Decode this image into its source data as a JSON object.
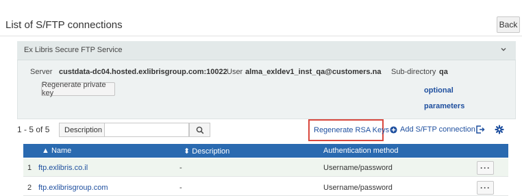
{
  "page": {
    "title": "List of S/FTP connections",
    "back_label": "Back"
  },
  "panel": {
    "title": "Ex Libris Secure FTP Service",
    "server_label": "Server",
    "server_value": "custdata-dc04.hosted.exlibrisgroup.com:10022",
    "user_label": "User",
    "user_value": "alma_exldev1_inst_qa@customers.na",
    "subdir_label": "Sub-directory",
    "subdir_value": "qa",
    "regen_key_label": "Regenerate private key",
    "optional_line1": "optional",
    "optional_line2": "parameters"
  },
  "toolbar": {
    "count": "1 - 5 of 5",
    "field_label": "Description",
    "search_value": "",
    "regen_rsa_label": "Regenerate RSA Keys",
    "add_label": "Add S/FTP connection"
  },
  "table": {
    "headers": {
      "name": "▲ Name",
      "description": "⬍ Description",
      "auth": "Authentication method"
    },
    "rows": [
      {
        "num": "1",
        "name": "ftp.exlibris.co.il",
        "description": "-",
        "auth": "Username/password",
        "more": "···"
      },
      {
        "num": "2",
        "name": "ftp.exlibrisgroup.com",
        "description": "-",
        "auth": "Username/password",
        "more": "···"
      }
    ]
  },
  "icons": {
    "chevron": "chevron-down-icon",
    "search": "search-icon",
    "add": "plus-circle-icon",
    "export": "export-icon",
    "settings": "gear-icon"
  },
  "colors": {
    "link": "#1d4e9e",
    "header_bg": "#2a6ab0",
    "highlight": "#d9473c",
    "row_alt": "#eff5ef"
  }
}
